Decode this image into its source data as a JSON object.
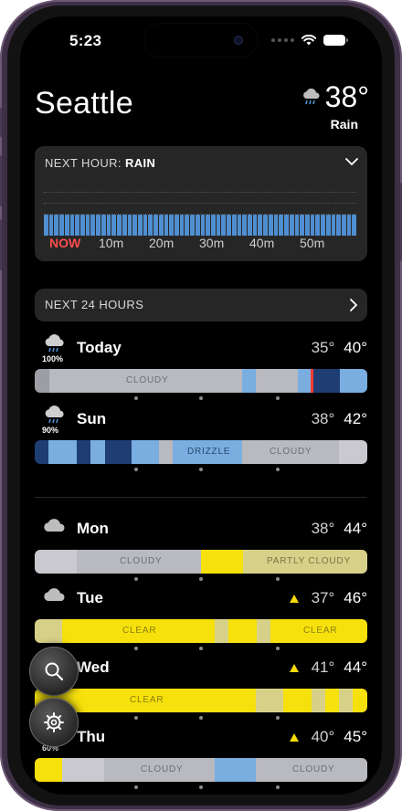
{
  "status_bar": {
    "time": "5:23"
  },
  "location": {
    "city": "Seattle",
    "temperature": "38°",
    "condition": "Rain",
    "icon": "rain-cloud-icon"
  },
  "next_hour": {
    "title_prefix": "NEXT HOUR:",
    "title_value": "RAIN",
    "ticks": [
      "NOW",
      "10m",
      "20m",
      "30m",
      "40m",
      "50m"
    ],
    "precip_fraction": 0.75
  },
  "next_24": {
    "label": "NEXT 24 HOURS"
  },
  "days": [
    {
      "name": "Today",
      "icon": "rain-cloud-icon",
      "precip": "100%",
      "low": "35°",
      "high": "40°",
      "alert": false,
      "labels": [
        "CLOUDY"
      ]
    },
    {
      "name": "Sun",
      "icon": "rain-cloud-icon",
      "precip": "90%",
      "low": "38°",
      "high": "42°",
      "alert": false,
      "labels": [
        "DRIZZLE",
        "CLOUDY"
      ]
    },
    {
      "name": "Mon",
      "icon": "cloud-icon",
      "precip": "",
      "low": "38°",
      "high": "44°",
      "alert": false,
      "labels": [
        "CLOUDY",
        "PARTLY CLOUDY"
      ]
    },
    {
      "name": "Tue",
      "icon": "cloud-icon",
      "precip": "",
      "low": "37°",
      "high": "46°",
      "alert": true,
      "labels": [
        "CLEAR",
        "CLEAR"
      ]
    },
    {
      "name": "Wed",
      "icon": "sun-icon",
      "precip": "",
      "low": "41°",
      "high": "44°",
      "alert": true,
      "labels": [
        "CLEAR"
      ]
    },
    {
      "name": "Thu",
      "icon": "rain-cloud-icon",
      "precip": "60%",
      "low": "40°",
      "high": "45°",
      "alert": true,
      "labels": [
        "CLOUDY",
        "CLOUDY"
      ]
    }
  ],
  "colors": {
    "cloudy": "#b9b9c0",
    "cloudy_dark": "#9d9da6",
    "rain": "#7aaee0",
    "rain_dark": "#3c6fae",
    "rain_deep": "#1e3d73",
    "clear": "#f6e10c",
    "partly": "#d7d088",
    "alert": "#f5d90a",
    "now": "#ff4d4d"
  },
  "floating_buttons": {
    "search": "search-icon",
    "settings": "gear-icon"
  }
}
